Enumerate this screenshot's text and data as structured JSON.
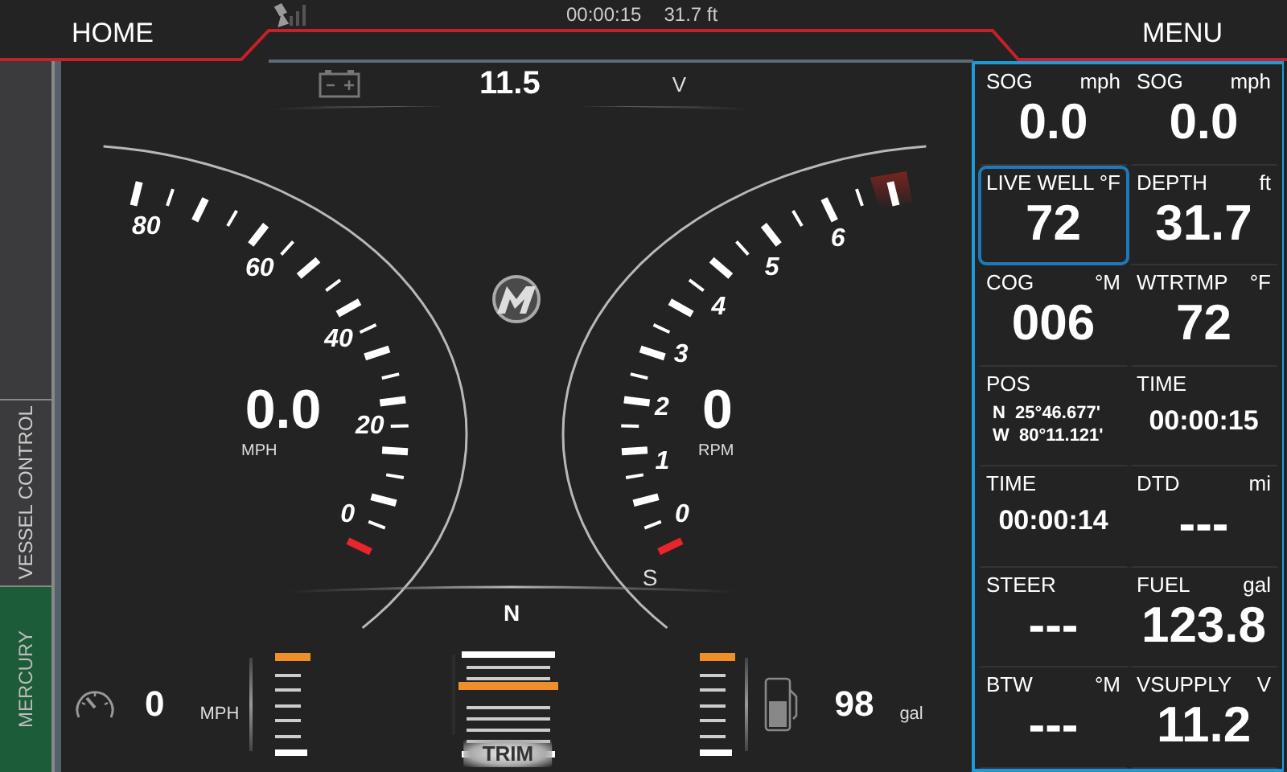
{
  "top_bar": {
    "home": "HOME",
    "menu": "MENU",
    "time": "00:00:15",
    "depth": "31.7 ft"
  },
  "side_tabs": [
    {
      "label": "VESSEL CONTROL",
      "selected": false
    },
    {
      "label": "MERCURY",
      "selected": true
    }
  ],
  "voltage": {
    "value": "11.5",
    "unit": "V"
  },
  "speedometer": {
    "scale": [
      "0",
      "20",
      "40",
      "60",
      "80"
    ],
    "value": "0.0",
    "unit": "MPH"
  },
  "tachometer": {
    "scale": [
      "0",
      "1",
      "2",
      "3",
      "4",
      "5",
      "6"
    ],
    "value": "0",
    "unit": "RPM",
    "mode": "S"
  },
  "gear": "N",
  "bottom": {
    "speed": "0",
    "speed_unit": "MPH",
    "left_tab": {
      "level": 1
    },
    "trim": {
      "label": "TRIM",
      "level": 0.62
    },
    "right_tab": {
      "level": 1
    },
    "fuel": "98",
    "fuel_unit": "gal"
  },
  "data_panel": [
    {
      "kind": "big",
      "label": "SOG",
      "unit": "mph",
      "value": "0.0",
      "selected": false
    },
    {
      "kind": "big",
      "label": "SOG",
      "unit": "mph",
      "value": "0.0",
      "selected": false
    },
    {
      "kind": "big",
      "label": "LIVE WELL",
      "unit": "°F",
      "value": "72",
      "selected": true
    },
    {
      "kind": "big",
      "label": "DEPTH",
      "unit": "ft",
      "value": "31.7",
      "selected": false
    },
    {
      "kind": "big",
      "label": "COG",
      "unit": "°M",
      "value": "006",
      "selected": false
    },
    {
      "kind": "big",
      "label": "WTRTMP",
      "unit": "°F",
      "value": "72",
      "selected": false
    },
    {
      "kind": "position",
      "label": "POS",
      "lines": [
        "N  25°46.677'",
        "W  80°11.121'"
      ],
      "selected": false
    },
    {
      "kind": "time",
      "label": "TIME",
      "value": "00:00:15",
      "selected": false
    },
    {
      "kind": "time",
      "label": "TIME",
      "value": "00:00:14",
      "selected": false
    },
    {
      "kind": "big",
      "label": "DTD",
      "unit": "mi",
      "value": "---",
      "selected": false
    },
    {
      "kind": "big",
      "label": "STEER",
      "value": "---",
      "selected": false
    },
    {
      "kind": "big",
      "label": "FUEL",
      "unit": "gal",
      "value": "123.8",
      "selected": false
    },
    {
      "kind": "big",
      "label": "BTW",
      "unit": "°M",
      "value": "---",
      "selected": false
    },
    {
      "kind": "big",
      "label": "VSUPPLY",
      "unit": "V",
      "value": "11.2",
      "selected": false
    }
  ]
}
